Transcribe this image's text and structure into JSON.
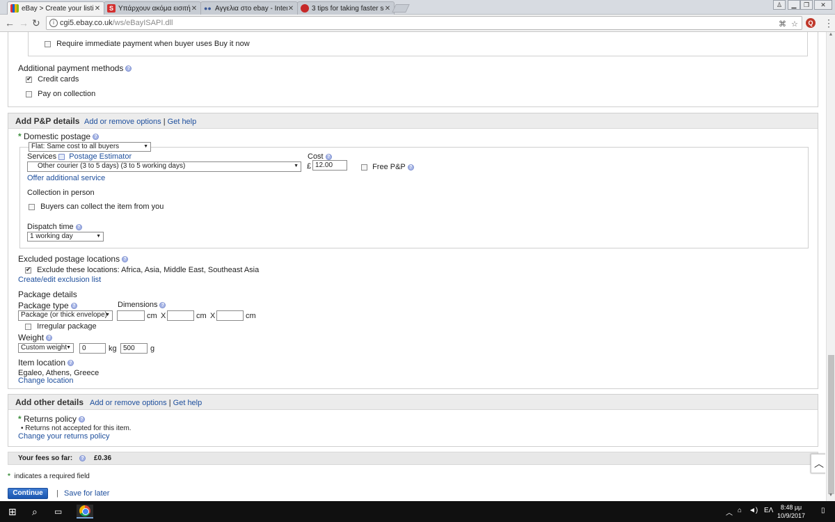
{
  "browser": {
    "tabs": [
      {
        "title": "eBay > Create your listin",
        "favicon_color": "#e53238"
      },
      {
        "title": "Υπάρχουν ακόμα εισιτή",
        "favicon_color": "#d32f2f"
      },
      {
        "title": "Αγγελια στο ebay - Inter",
        "favicon_color": "#3b5998"
      },
      {
        "title": "3 tips for taking faster sc",
        "favicon_color": "#c62828"
      }
    ],
    "url_host": "cgi5.ebay.co.uk",
    "url_path": "/ws/eBayISAPI.dll"
  },
  "payment": {
    "immediate_payment_label": "Require immediate payment when buyer uses Buy it now",
    "immediate_payment_checked": false,
    "additional_title": "Additional payment methods",
    "credit_cards_label": "Credit cards",
    "credit_cards_checked": true,
    "pay_on_collection_label": "Pay on collection",
    "pay_on_collection_checked": false
  },
  "pp": {
    "title": "Add P&P details",
    "add_remove": "Add or remove options",
    "sep": "|",
    "get_help": "Get help",
    "domestic_title": "Domestic postage",
    "domestic_type": "Flat: Same cost to all buyers",
    "services_label": "Services",
    "postage_estimator": "Postage Estimator",
    "service_value": "Other courier (3 to 5 days) (3 to 5 working days)",
    "cost_label": "Cost",
    "currency": "£",
    "cost_value": "12.00",
    "free_pp_label": "Free P&P",
    "offer_additional": "Offer additional service",
    "collection_title": "Collection in person",
    "buyers_collect_label": "Buyers can collect the item from you",
    "dispatch_label": "Dispatch time",
    "dispatch_value": "1 working day",
    "excluded_title": "Excluded postage locations",
    "exclude_label": "Exclude these locations: Africa, Asia, Middle East, Southeast Asia",
    "create_edit": "Create/edit exclusion list",
    "package_details": "Package details",
    "package_type_label": "Package type",
    "package_type_value": "Package (or thick envelope)",
    "dimensions_label": "Dimensions",
    "unit_cm": "cm",
    "x": "X",
    "irregular_label": "Irregular package",
    "weight_label": "Weight",
    "weight_type": "Custom weight",
    "weight_kg": "0",
    "unit_kg": "kg",
    "weight_g": "500",
    "unit_g": "g",
    "item_location_label": "Item location",
    "item_location_value": "Egaleo, Athens, Greece",
    "change_location": "Change location"
  },
  "other": {
    "title": "Add other details",
    "add_remove": "Add or remove options",
    "sep": "|",
    "get_help": "Get help",
    "returns_title": "Returns policy",
    "returns_bullet": "Returns not accepted for this item.",
    "change_returns": "Change your returns policy"
  },
  "fees": {
    "label": "Your fees so far:",
    "value": "£0.36"
  },
  "footer": {
    "required_note": "indicates a required field",
    "star": "*",
    "continue_label": "Continue",
    "sep": "|",
    "save_later": "Save for later"
  },
  "taskbar": {
    "lang": "ΕΛ",
    "time": "8:48 μμ",
    "date": "10/9/2017"
  }
}
